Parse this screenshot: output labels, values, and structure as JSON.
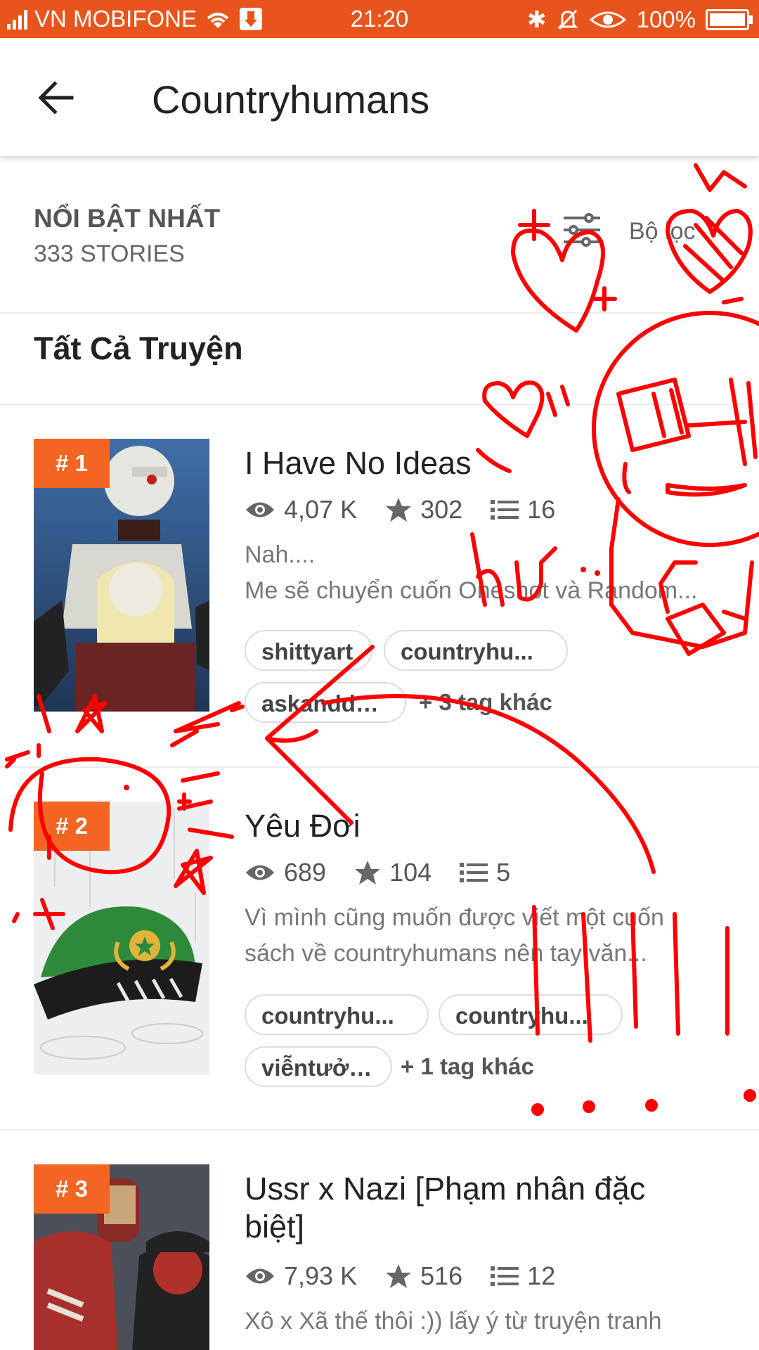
{
  "status_bar": {
    "carrier": "VN MOBIFONE",
    "time": "21:20",
    "battery": "100%"
  },
  "app_bar": {
    "title": "Countryhumans"
  },
  "sort_bar": {
    "label": "NỔI BẬT NHẤT",
    "count": "333 STORIES",
    "more": "Bộ lọc"
  },
  "section_title": "Tất Cả Truyện",
  "stories": [
    {
      "rank": "# 1",
      "title": "I Have No Ideas",
      "reads": "4,07 K",
      "votes": "302",
      "parts": "16",
      "desc_line1": "Nah....",
      "desc_line2": "Me sẽ chuyển cuốn Oneshot và Random...",
      "tags": [
        "shittyart",
        "countryhu...",
        "askanddare"
      ],
      "more_tags": "+ 3 tag khác"
    },
    {
      "rank": "# 2",
      "title": "Yêu Đơi",
      "reads": "689",
      "votes": "104",
      "parts": "5",
      "desc_line1": "Vì mình cũng muốn được viết một cuốn",
      "desc_line2": "sách về countryhumans nên tay văn...",
      "tags": [
        "countryhu...",
        "countryhu...",
        "viễntưởng"
      ],
      "more_tags": "+ 1 tag khác"
    },
    {
      "rank": "# 3",
      "title_line1": "Ussr x Nazi [Phạm nhân đặc",
      "title_line2": "biệt]",
      "reads": "7,93 K",
      "votes": "516",
      "parts": "12",
      "desc_line1": "Xô x Xã thế thôi :)) lấy ý từ truyện tranh"
    }
  ],
  "doodle_text": "hư",
  "colors": {
    "status_bar": "#e8541c",
    "rank_badge": "#f26522",
    "doodle": "#ff0000"
  }
}
